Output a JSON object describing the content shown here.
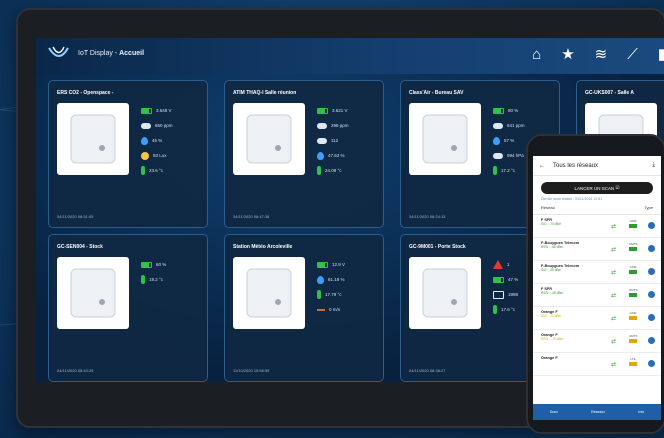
{
  "app": {
    "title_prefix": "IoT Display - ",
    "title_page": "Accueil"
  },
  "nav": [
    {
      "name": "home-icon",
      "glyph": "⌂"
    },
    {
      "name": "star-icon",
      "glyph": "★"
    },
    {
      "name": "layers-icon",
      "glyph": "≋"
    },
    {
      "name": "chart-icon",
      "glyph": "⟋"
    },
    {
      "name": "trash-icon",
      "glyph": "▮"
    }
  ],
  "cards": [
    {
      "title": "ERS CO2 - Openspace -",
      "date": "04/11/2020 08:51:05",
      "metrics": [
        {
          "icon": "battery",
          "value": "3.648 V"
        },
        {
          "icon": "co2",
          "value": "650 ppm"
        },
        {
          "icon": "humidity",
          "value": "45 %"
        },
        {
          "icon": "light",
          "value": "93 Lux"
        },
        {
          "icon": "temperature",
          "value": "23.6 °c"
        }
      ]
    },
    {
      "title": "ATIM THAQ-I Salle réunion",
      "date": "04/11/2020 08:47:38",
      "metrics": [
        {
          "icon": "battery",
          "value": "3.621 V"
        },
        {
          "icon": "co2",
          "value": "298 ppm"
        },
        {
          "icon": "voc",
          "value": "112"
        },
        {
          "icon": "humidity",
          "value": "47.53 %"
        },
        {
          "icon": "temperature",
          "value": "24.08 °c"
        }
      ]
    },
    {
      "title": "Class'Air - Bureau SAV",
      "date": "04/11/2020 08:24:13",
      "metrics": [
        {
          "icon": "battery",
          "value": "80 %"
        },
        {
          "icon": "co2",
          "value": "541 ppm"
        },
        {
          "icon": "humidity",
          "value": "57 %"
        },
        {
          "icon": "pressure",
          "value": "994 hPa"
        },
        {
          "icon": "temperature",
          "value": "17.2 °c"
        }
      ]
    },
    {
      "title": "GC-UKS007 - Salle A",
      "date": "",
      "metrics": []
    },
    {
      "title": "GC-SEN004 - Stock",
      "date": "04/11/2020 08:40:25",
      "metrics": [
        {
          "icon": "battery",
          "value": "60 %"
        },
        {
          "icon": "temperature",
          "value": "19.2 °c"
        }
      ]
    },
    {
      "title": "Station Météo Arcoleville",
      "date": "11/10/2020 15:56:59",
      "metrics": [
        {
          "icon": "battery",
          "value": "12.9 V"
        },
        {
          "icon": "humidity",
          "value": "61.18 %"
        },
        {
          "icon": "temperature",
          "value": "17.79 °c"
        },
        {
          "icon": "wind",
          "value": "0 m/s"
        }
      ]
    },
    {
      "title": "GC-9M001 - Porte Stock",
      "date": "04/11/2020 08:38:27",
      "metrics": [
        {
          "icon": "alarm",
          "value": "1"
        },
        {
          "icon": "battery",
          "value": "47 %"
        },
        {
          "icon": "hours",
          "value": "1998"
        },
        {
          "icon": "temperature",
          "value": "17.6 °c"
        }
      ]
    }
  ],
  "phone": {
    "header": "Tous les réseaux",
    "scan_button": "LANCER UN SCAN",
    "last_update": "Dernier scan réalisé : 04/11/2016 12:51",
    "col_network": "Réseau",
    "col_type": "Type",
    "rows": [
      {
        "name": "F SFR",
        "info": "SIG : -70 dBm",
        "type": "GSM",
        "color": "#2e9b2e"
      },
      {
        "name": "F-Bouygues Telecom",
        "info": "RSSI : -66 dBm",
        "type": "UMTS",
        "color": "#2e9b2e"
      },
      {
        "name": "F-Bouygues Telecom",
        "info": "SIG : -55 dBm",
        "type": "GSM",
        "color": "#2e9b2e"
      },
      {
        "name": "F SFR",
        "info": "RSSI : -49 dBm",
        "type": "UMTS",
        "color": "#2e9b2e"
      },
      {
        "name": "Orange F",
        "info": "SIG : -73 dBm",
        "type": "GSM",
        "color": "#e0a800"
      },
      {
        "name": "Orange F",
        "info": "RSSI : -78 dBm",
        "type": "UMTS",
        "color": "#e0a800"
      },
      {
        "name": "Orange F",
        "info": "",
        "type": "LTE",
        "color": "#e0a800"
      }
    ],
    "footer": [
      "Scan",
      "Réseaux",
      "Info"
    ]
  }
}
